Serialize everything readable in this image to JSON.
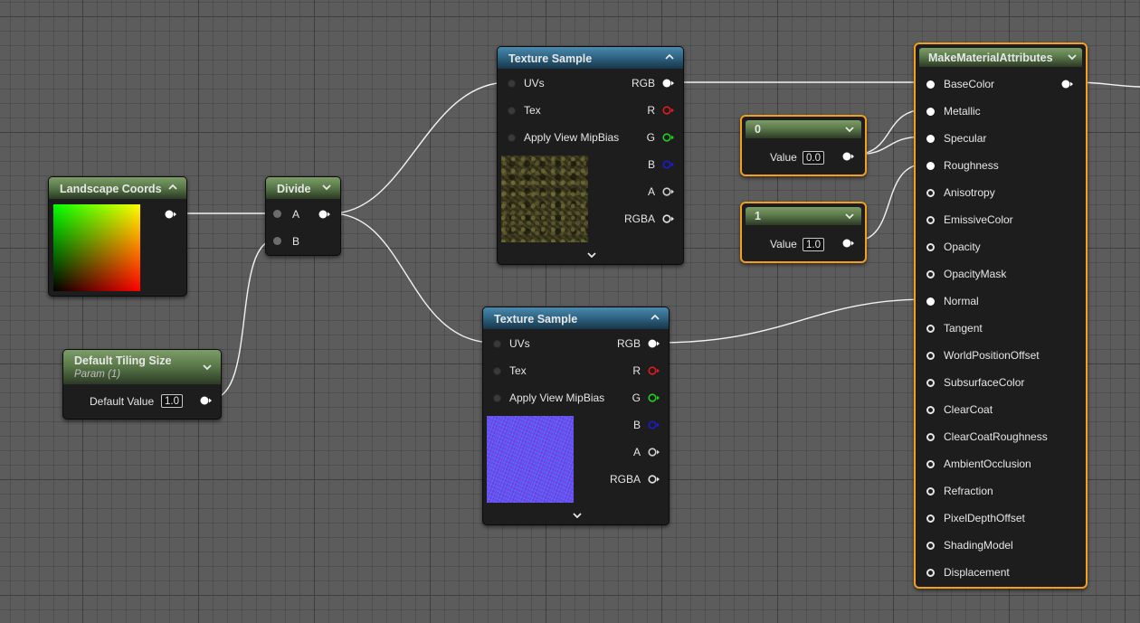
{
  "nodes": {
    "landscape_coords": {
      "title": "Landscape Coords"
    },
    "divide": {
      "title": "Divide",
      "inputs": [
        "A",
        "B"
      ]
    },
    "tiling": {
      "title": "Default Tiling Size",
      "subtitle": "Param (1)",
      "field_label": "Default Value",
      "field_value": "1.0"
    },
    "tex1": {
      "title": "Texture Sample",
      "inputs": [
        "UVs",
        "Tex",
        "Apply View MipBias"
      ],
      "outputs": [
        "RGB",
        "R",
        "G",
        "B",
        "A",
        "RGBA"
      ]
    },
    "tex2": {
      "title": "Texture Sample",
      "inputs": [
        "UVs",
        "Tex",
        "Apply View MipBias"
      ],
      "outputs": [
        "RGB",
        "R",
        "G",
        "B",
        "A",
        "RGBA"
      ]
    },
    "const0": {
      "title": "0",
      "field_label": "Value",
      "field_value": "0.0"
    },
    "const1": {
      "title": "1",
      "field_label": "Value",
      "field_value": "1.0"
    },
    "mma": {
      "title": "MakeMaterialAttributes",
      "inputs": [
        "BaseColor",
        "Metallic",
        "Specular",
        "Roughness",
        "Anisotropy",
        "EmissiveColor",
        "Opacity",
        "OpacityMask",
        "Normal",
        "Tangent",
        "WorldPositionOffset",
        "SubsurfaceColor",
        "ClearCoat",
        "ClearCoatRoughness",
        "AmbientOcclusion",
        "Refraction",
        "PixelDepthOffset",
        "ShadingModel",
        "Displacement"
      ]
    }
  },
  "colors": {
    "selection": "#f59f1d",
    "pin_r": "#e01b1b",
    "pin_g": "#1fd11f",
    "pin_b": "#1b1bd6"
  }
}
